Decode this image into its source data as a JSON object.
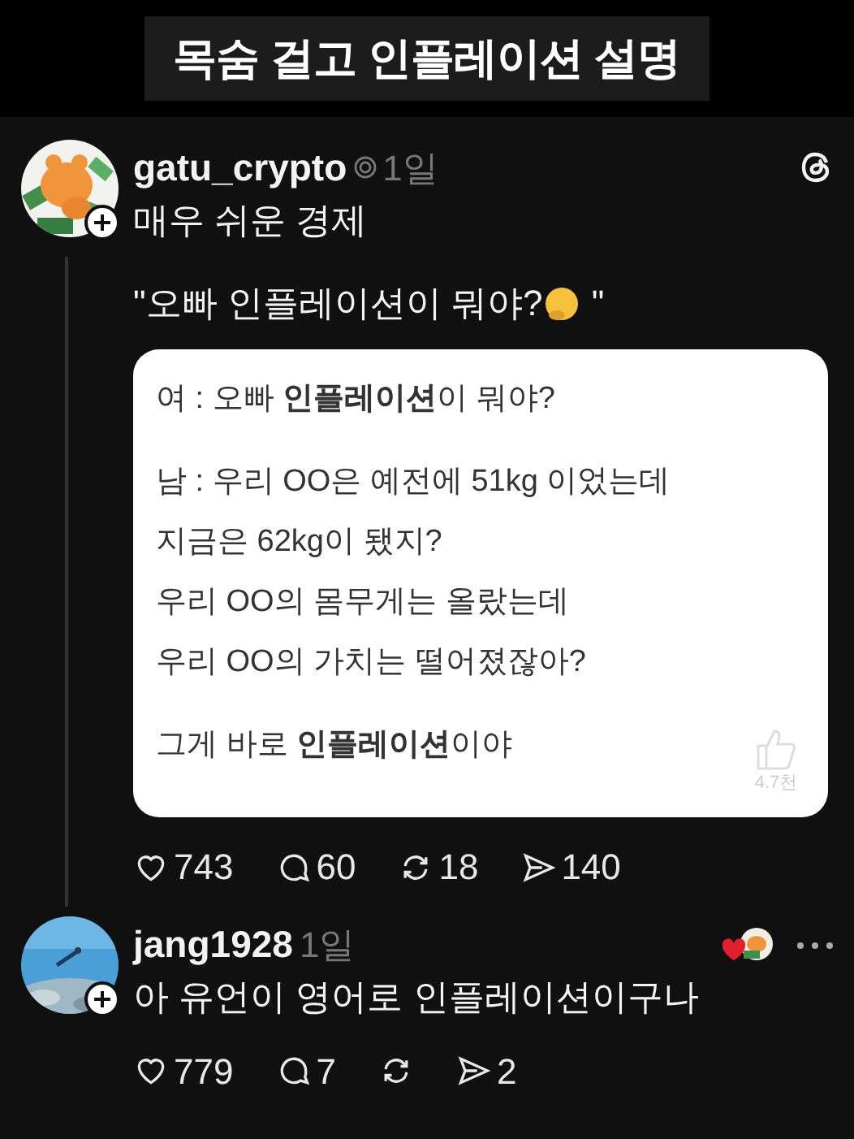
{
  "banner": {
    "title": "목숨 걸고 인플레이션 설명"
  },
  "posts": [
    {
      "username": "gatu_crypto",
      "verified": true,
      "time": "1일",
      "threads_logo": true,
      "more_menu": false,
      "liked_by_author": false,
      "text": "매우 쉬운 경제",
      "quote": {
        "before": "\"오빠 인플레이션이 뭐야?",
        "after": " \""
      },
      "card": {
        "paragraphs": [
          [
            "여 : 오빠 **인플레이션**이 뭐야?"
          ],
          [
            "남 : 우리 OO은 예전에 51kg 이었는데",
            "지금은 62kg이 됐지?",
            "우리 OO의 몸무게는 올랐는데",
            "우리 OO의 가치는 떨어졌잖아?"
          ],
          [
            "그게 바로 **인플레이션**이야"
          ]
        ],
        "like_count": "4.7천"
      },
      "stats": [
        {
          "kind": "like",
          "count": "743"
        },
        {
          "kind": "reply",
          "count": "60"
        },
        {
          "kind": "repost",
          "count": "18"
        },
        {
          "kind": "share",
          "count": "140"
        }
      ]
    },
    {
      "username": "jang1928",
      "verified": false,
      "time": "1일",
      "threads_logo": false,
      "more_menu": true,
      "liked_by_author": true,
      "text": "아 유언이 영어로 인플레이션이구나",
      "stats": [
        {
          "kind": "like",
          "count": "779"
        },
        {
          "kind": "reply",
          "count": "7"
        },
        {
          "kind": "repost"
        },
        {
          "kind": "share",
          "count": "2"
        }
      ]
    }
  ]
}
